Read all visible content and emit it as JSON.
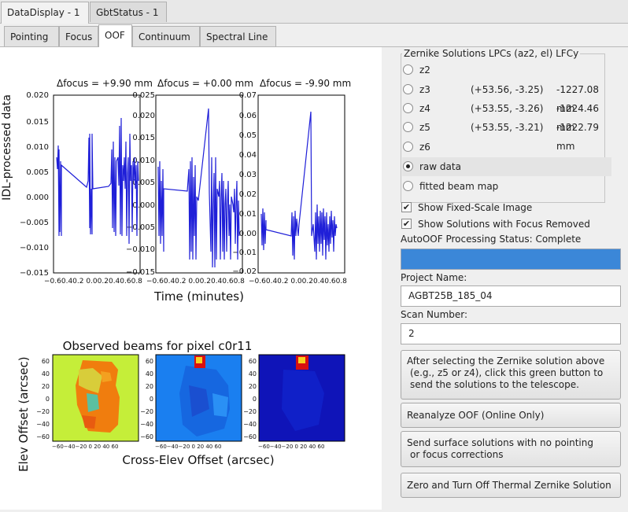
{
  "top_tabs": [
    "DataDisplay - 1",
    "GbtStatus - 1"
  ],
  "sub_tabs": [
    "Pointing",
    "Focus",
    "OOF",
    "Continuum",
    "Spectral Line"
  ],
  "plots": {
    "ylabel": "IDL-processed data",
    "xlabel": "Time (minutes)",
    "panel_titles": [
      "Δfocus = +9.90 mm",
      "Δfocus = +0.00 mm",
      "Δfocus = -9.90 mm"
    ],
    "panel1_yticks": [
      "0.020",
      "0.015",
      "0.010",
      "0.005",
      "0.000",
      "−0.005",
      "−0.010",
      "−0.015"
    ],
    "panel2_yticks": [
      "0.025",
      "0.020",
      "0.015",
      "0.010",
      "0.005",
      "0.000",
      "−0.005",
      "−0.010",
      "−0.015"
    ],
    "panel3_yticks": [
      "0.07",
      "0.06",
      "0.05",
      "0.04",
      "0.03",
      "0.02",
      "0.01",
      "0.00",
      "−0.01",
      "−0.02"
    ],
    "xticks_text": "−0.60.40.2 0.00.20.40.60.8"
  },
  "beams": {
    "title": "Observed beams for pixel c0r11",
    "ylabel": "Elev Offset (arcsec)",
    "xlabel": "Cross-Elev Offset (arcsec)",
    "yticks": [
      "60",
      "40",
      "20",
      "0",
      "−20",
      "−40",
      "−60"
    ],
    "xticks_text": "−60−40−20 0  20  40  60"
  },
  "zernike": {
    "title": "Zernike Solutions   LPCs (az2, el)   LFCy",
    "rows": [
      {
        "name": "z2",
        "lpc": "",
        "lfc": "",
        "selected": false
      },
      {
        "name": "z3",
        "lpc": "(+53.56, -3.25)",
        "lfc": "-1227.08 mm",
        "selected": false
      },
      {
        "name": "z4",
        "lpc": "(+53.55, -3.26)",
        "lfc": "-1224.46 mm",
        "selected": false
      },
      {
        "name": "z5",
        "lpc": "(+53.55, -3.21)",
        "lfc": "-1222.79 mm",
        "selected": false
      },
      {
        "name": "z6",
        "lpc": "",
        "lfc": "",
        "selected": false
      },
      {
        "name": "raw data",
        "lpc": "",
        "lfc": "",
        "selected": true
      },
      {
        "name": "fitted beam map",
        "lpc": "",
        "lfc": "",
        "selected": false
      }
    ]
  },
  "checks": {
    "fixed_scale": "Show Fixed-Scale Image",
    "focus_removed": "Show Solutions with Focus Removed",
    "check_mark": "✔"
  },
  "status_text": "AutoOOF Processing Status: Complete",
  "progress": {
    "value": 1.0,
    "color": "#3b87d8"
  },
  "project": {
    "label": "Project Name:",
    "value": "AGBT25B_185_04"
  },
  "scan": {
    "label": "Scan Number:",
    "value": "2"
  },
  "buttons": {
    "send_lines": [
      "After selecting the Zernike solution above",
      "(e.g., z5 or z4), click this green button to",
      "send the solutions to the telescope."
    ],
    "reanalyze": "Reanalyze OOF (Online Only)",
    "surface_lines": [
      "Send surface solutions with no pointing",
      "or focus corrections"
    ],
    "zero": "Zero and Turn Off Thermal Zernike Solution"
  }
}
